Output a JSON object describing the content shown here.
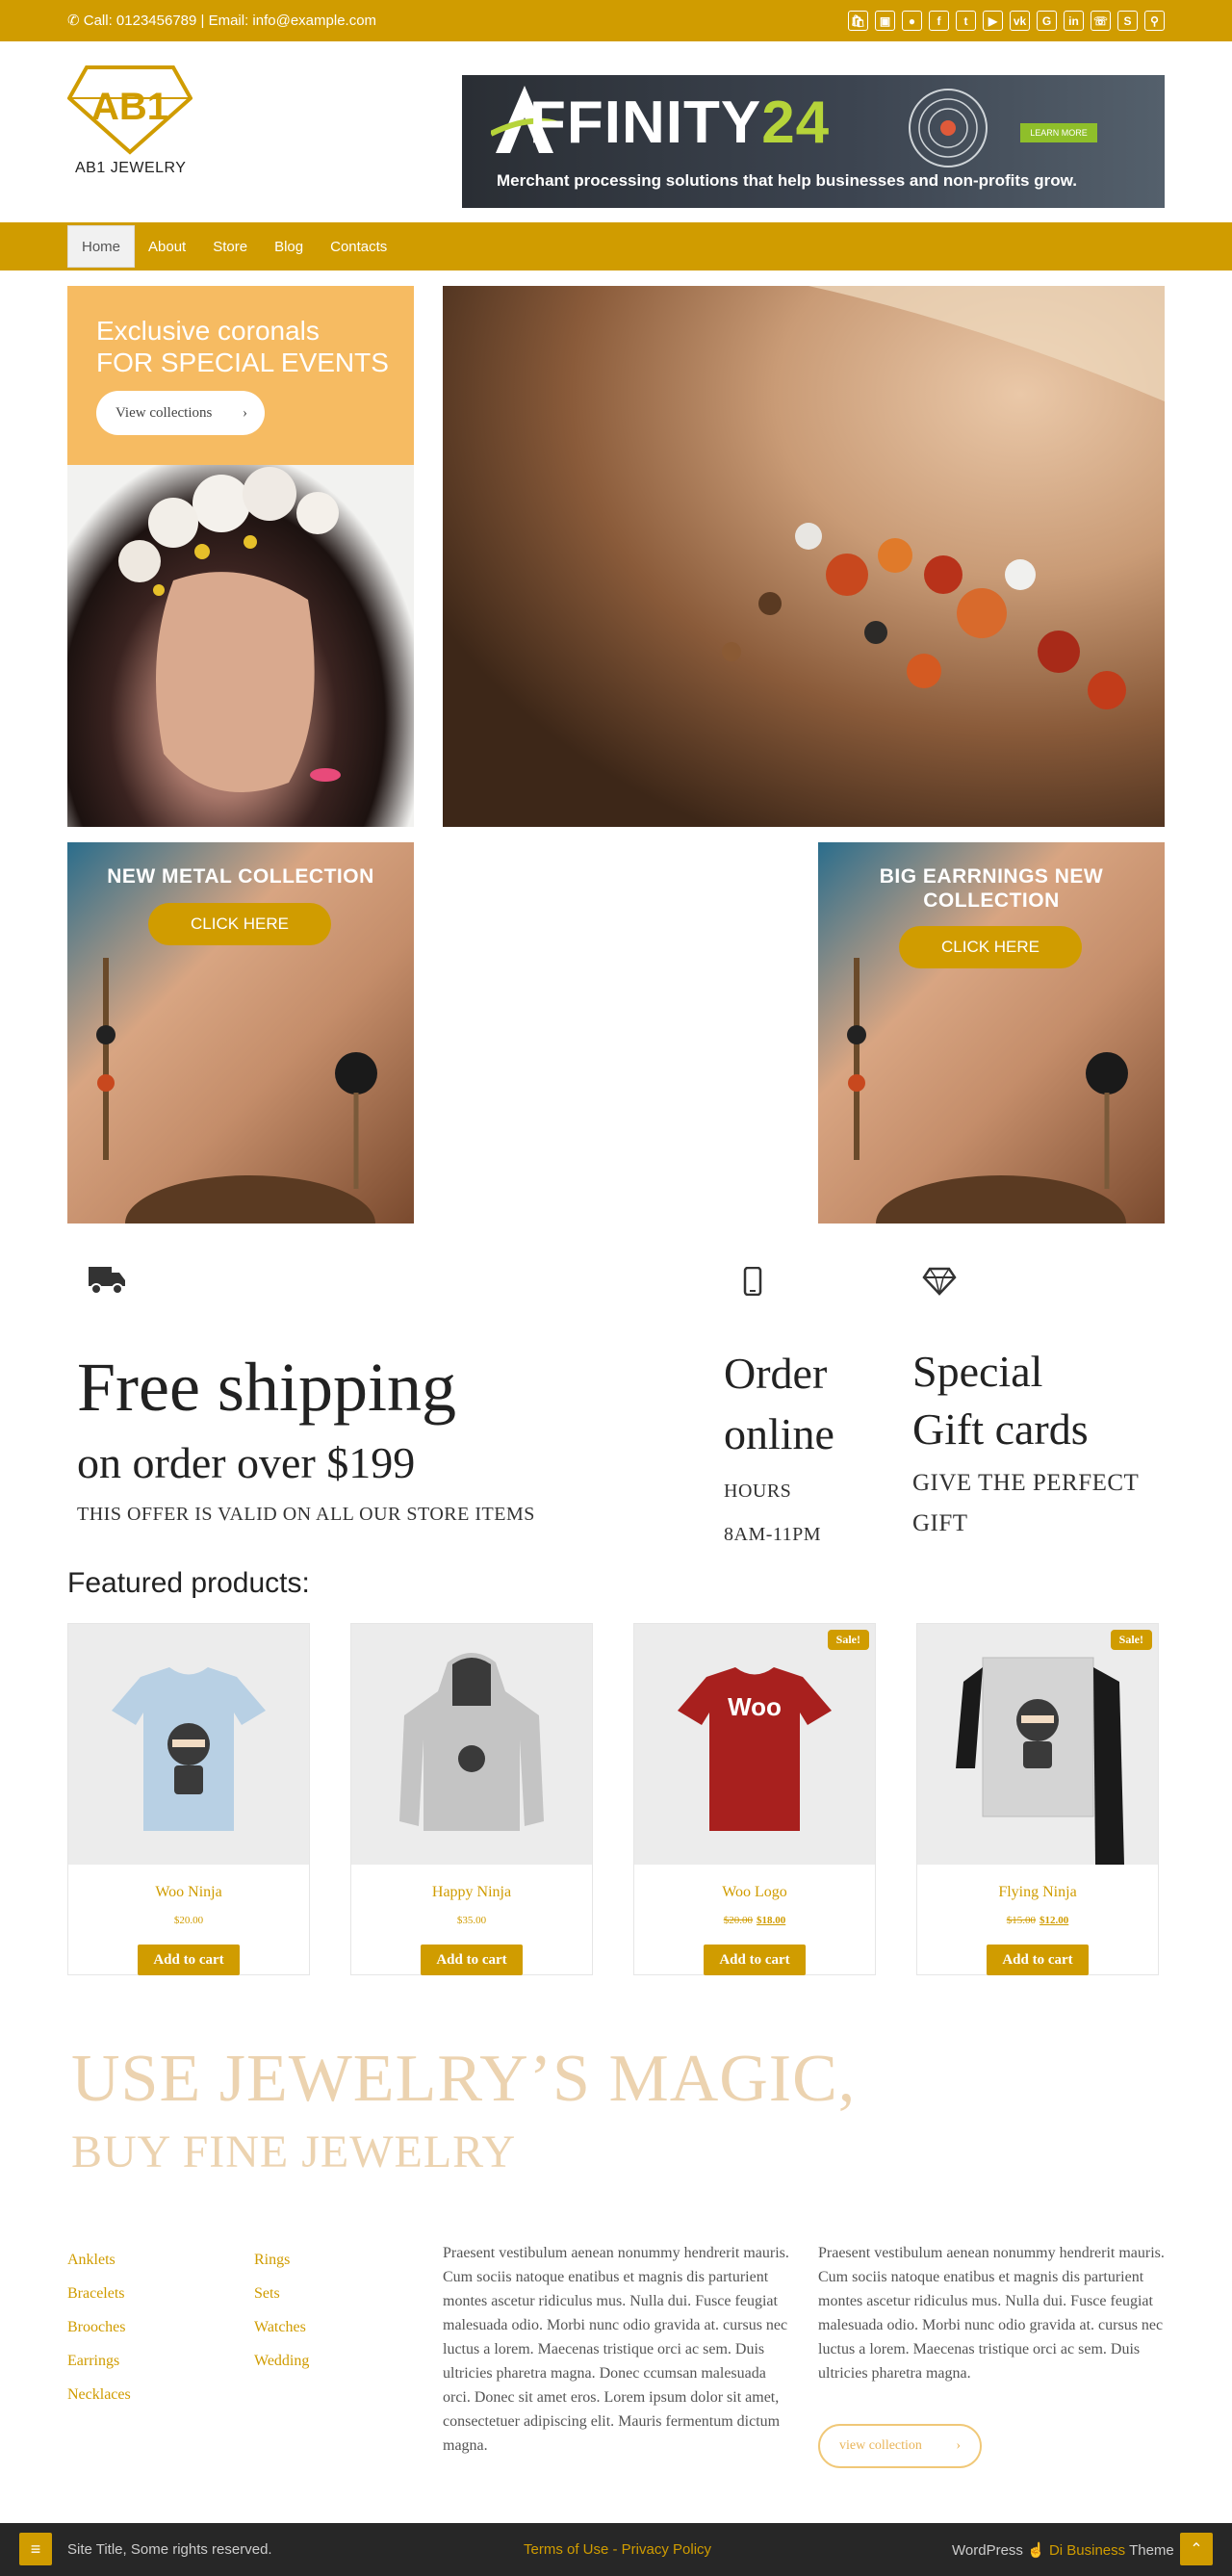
{
  "topbar": {
    "contact": "Call: 0123456789 | Email: info@example.com",
    "social_icons": [
      "shopping-bag-icon",
      "cart-icon",
      "user-icon",
      "facebook-icon",
      "twitter-icon",
      "youtube-icon",
      "vk-icon",
      "google-icon",
      "linkedin-icon",
      "whatsapp-icon",
      "skype-icon",
      "search-icon"
    ]
  },
  "header": {
    "logo_mark": "AB1",
    "logo_text": "AB1 JEWELRY",
    "banner": {
      "title_prefix": "FFINITY",
      "title_num": "24",
      "subtitle": "Merchant processing solutions that help businesses and non-profits grow.",
      "button": "LEARN MORE"
    }
  },
  "nav": {
    "items": [
      "Home",
      "About",
      "Store",
      "Blog",
      "Contacts"
    ]
  },
  "hero": {
    "promo_line1": "Exclusive coronals",
    "promo_line2": "FOR SPECIAL EVENTS",
    "promo_button": "View collections",
    "metal_title": "NEW METAL COLLECTION",
    "metal_button": "CLICK HERE",
    "earring_title": "BIG EARRNINGS NEW COLLECTION",
    "earring_button": "CLICK HERE"
  },
  "features": {
    "shipping_title": "Free shipping",
    "shipping_sub": "on order over $199",
    "shipping_note": "THIS OFFER IS VALID ON ALL OUR STORE ITEMS",
    "order_title_1": "Order",
    "order_title_2": "online",
    "order_label": "HOURS",
    "order_hours": "8AM-11PM",
    "gift_title_1": "Special",
    "gift_title_2": "Gift cards",
    "gift_sub_1": "GIVE THE PERFECT",
    "gift_sub_2": "GIFT"
  },
  "products": {
    "title": "Featured products:",
    "button_label": "Add to cart",
    "sale_label": "Sale!",
    "items": [
      {
        "name": "Woo Ninja",
        "old_price": "",
        "price": "$20.00"
      },
      {
        "name": "Happy Ninja",
        "old_price": "",
        "price": "$35.00"
      },
      {
        "name": "Woo Logo",
        "old_price": "$20.00",
        "price": "$18.00"
      },
      {
        "name": "Flying Ninja",
        "old_price": "$15.00",
        "price": "$12.00"
      }
    ],
    "tshirt_logo": "Woo"
  },
  "magic": {
    "title": "USE JEWELRY’S MAGIC,",
    "subtitle": "BUY FINE JEWELRY"
  },
  "footer": {
    "links_col1": [
      "Anklets",
      "Bracelets",
      "Brooches",
      "Earrings",
      "Necklaces"
    ],
    "links_col2": [
      "Rings",
      "Sets",
      "Watches",
      "Wedding"
    ],
    "para1": "Praesent vestibulum aenean nonummy hendrerit mauris. Cum sociis natoque enatibus et magnis dis parturient montes ascetur ridiculus mus. Nulla dui. Fusce feugiat malesuada odio. Morbi nunc odio gravida at. cursus nec luctus a lorem. Maecenas tristique orci ac sem. Duis ultricies pharetra magna. Donec ccumsan malesuada orci. Donec sit amet eros. Lorem ipsum dolor sit amet, consectetuer adipiscing elit. Mauris fermentum dictum magna.",
    "para2": "Praesent vestibulum aenean nonummy hendrerit mauris. Cum sociis natoque enatibus et magnis dis parturient montes ascetur ridiculus mus. Nulla dui. Fusce feugiat malesuada odio. Morbi nunc odio gravida at. cursus nec luctus a lorem. Maecenas tristique orci ac sem. Duis ultricies pharetra magna.",
    "collection_button": "view collection"
  },
  "bottombar": {
    "copyright": "Site Title, Some rights reserved.",
    "legal": "Terms of Use - Privacy Policy",
    "credit_prefix": "WordPress",
    "credit_theme": "Di Business",
    "credit_suffix": "Theme"
  },
  "colors": {
    "accent": "#d09c00",
    "promo": "#f6bb62",
    "magic_text": "#ecd3b0"
  }
}
